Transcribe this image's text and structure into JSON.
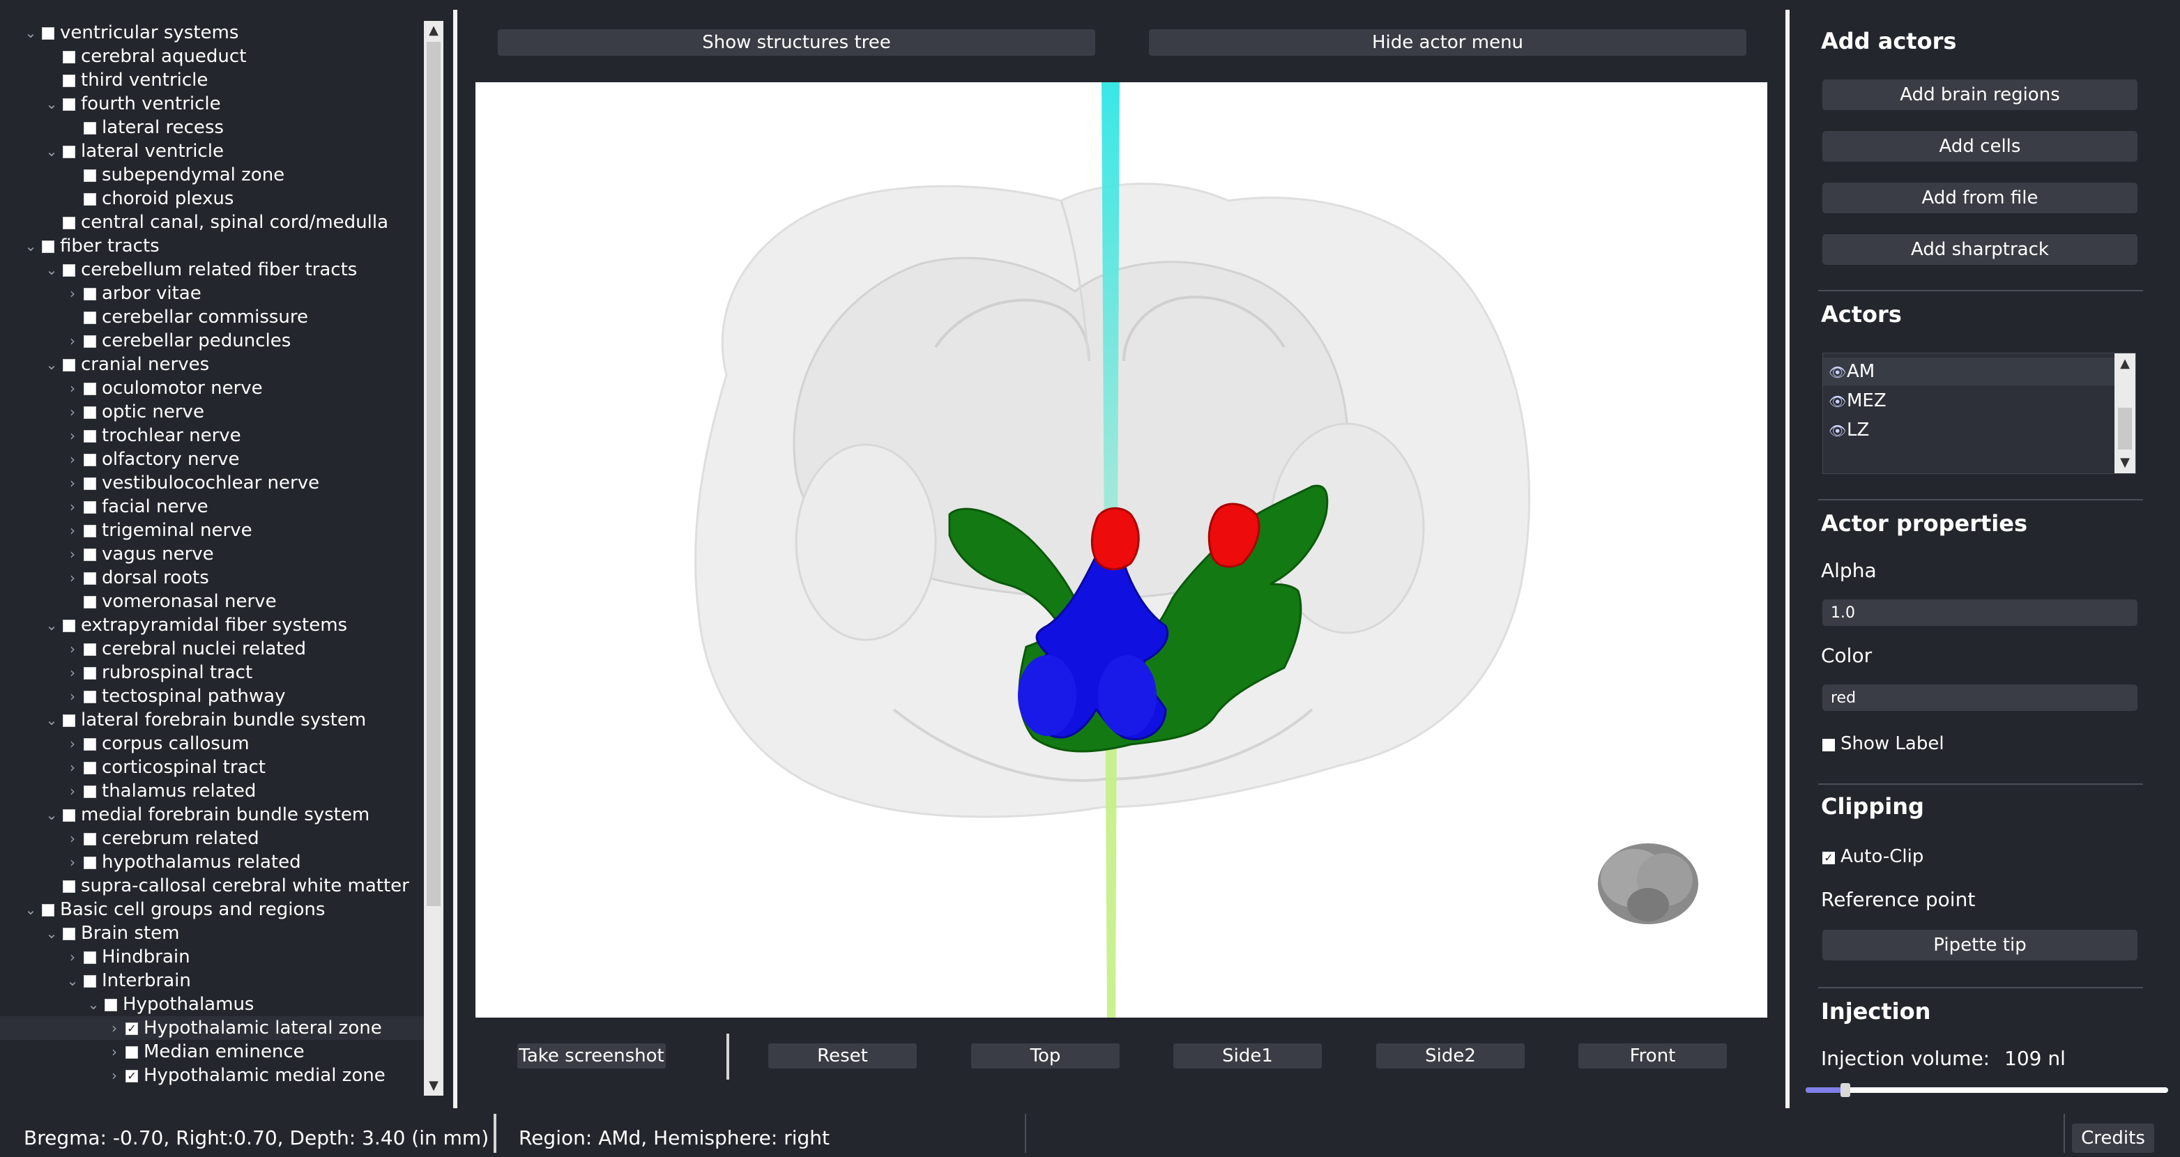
{
  "tree": {
    "items": [
      {
        "level": 0,
        "expanded": true,
        "checked": false,
        "label": "ventricular systems"
      },
      {
        "level": 1,
        "expanded": null,
        "checked": false,
        "label": "cerebral aqueduct"
      },
      {
        "level": 1,
        "expanded": null,
        "checked": false,
        "label": "third ventricle"
      },
      {
        "level": 1,
        "expanded": true,
        "checked": false,
        "label": "fourth ventricle"
      },
      {
        "level": 2,
        "expanded": null,
        "checked": false,
        "label": "lateral recess"
      },
      {
        "level": 1,
        "expanded": true,
        "checked": false,
        "label": "lateral ventricle"
      },
      {
        "level": 2,
        "expanded": null,
        "checked": false,
        "label": "subependymal zone"
      },
      {
        "level": 2,
        "expanded": null,
        "checked": false,
        "label": "choroid plexus"
      },
      {
        "level": 1,
        "expanded": null,
        "checked": false,
        "label": "central canal, spinal cord/medulla"
      },
      {
        "level": 0,
        "expanded": true,
        "checked": false,
        "label": "fiber tracts"
      },
      {
        "level": 1,
        "expanded": true,
        "checked": false,
        "label": "cerebellum related fiber tracts"
      },
      {
        "level": 2,
        "expanded": false,
        "checked": false,
        "label": "arbor vitae"
      },
      {
        "level": 2,
        "expanded": null,
        "checked": false,
        "label": "cerebellar commissure"
      },
      {
        "level": 2,
        "expanded": false,
        "checked": false,
        "label": "cerebellar peduncles"
      },
      {
        "level": 1,
        "expanded": true,
        "checked": false,
        "label": "cranial nerves"
      },
      {
        "level": 2,
        "expanded": false,
        "checked": false,
        "label": "oculomotor nerve"
      },
      {
        "level": 2,
        "expanded": false,
        "checked": false,
        "label": "optic nerve"
      },
      {
        "level": 2,
        "expanded": false,
        "checked": false,
        "label": "trochlear nerve"
      },
      {
        "level": 2,
        "expanded": false,
        "checked": false,
        "label": "olfactory nerve"
      },
      {
        "level": 2,
        "expanded": false,
        "checked": false,
        "label": "vestibulocochlear nerve"
      },
      {
        "level": 2,
        "expanded": false,
        "checked": false,
        "label": "facial nerve"
      },
      {
        "level": 2,
        "expanded": false,
        "checked": false,
        "label": "trigeminal nerve"
      },
      {
        "level": 2,
        "expanded": false,
        "checked": false,
        "label": "vagus nerve"
      },
      {
        "level": 2,
        "expanded": false,
        "checked": false,
        "label": "dorsal roots"
      },
      {
        "level": 2,
        "expanded": null,
        "checked": false,
        "label": "vomeronasal nerve"
      },
      {
        "level": 1,
        "expanded": true,
        "checked": false,
        "label": "extrapyramidal fiber systems"
      },
      {
        "level": 2,
        "expanded": false,
        "checked": false,
        "label": "cerebral nuclei related"
      },
      {
        "level": 2,
        "expanded": false,
        "checked": false,
        "label": "rubrospinal tract"
      },
      {
        "level": 2,
        "expanded": false,
        "checked": false,
        "label": "tectospinal pathway"
      },
      {
        "level": 1,
        "expanded": true,
        "checked": false,
        "label": "lateral forebrain bundle system"
      },
      {
        "level": 2,
        "expanded": false,
        "checked": false,
        "label": "corpus callosum"
      },
      {
        "level": 2,
        "expanded": false,
        "checked": false,
        "label": "corticospinal tract"
      },
      {
        "level": 2,
        "expanded": false,
        "checked": false,
        "label": "thalamus related"
      },
      {
        "level": 1,
        "expanded": true,
        "checked": false,
        "label": "medial forebrain bundle system"
      },
      {
        "level": 2,
        "expanded": false,
        "checked": false,
        "label": "cerebrum related"
      },
      {
        "level": 2,
        "expanded": false,
        "checked": false,
        "label": "hypothalamus related"
      },
      {
        "level": 1,
        "expanded": null,
        "checked": false,
        "label": "supra-callosal cerebral white matter"
      },
      {
        "level": 0,
        "expanded": true,
        "checked": false,
        "label": "Basic cell groups and regions"
      },
      {
        "level": 1,
        "expanded": true,
        "checked": false,
        "label": "Brain stem"
      },
      {
        "level": 2,
        "expanded": false,
        "checked": false,
        "label": "Hindbrain"
      },
      {
        "level": 2,
        "expanded": true,
        "checked": false,
        "label": "Interbrain"
      },
      {
        "level": 3,
        "expanded": true,
        "checked": false,
        "label": "Hypothalamus"
      },
      {
        "level": 4,
        "expanded": false,
        "checked": true,
        "label": "Hypothalamic lateral zone",
        "selected": true
      },
      {
        "level": 4,
        "expanded": false,
        "checked": false,
        "label": "Median eminence"
      },
      {
        "level": 4,
        "expanded": false,
        "checked": true,
        "label": "Hypothalamic medial zone"
      }
    ]
  },
  "toolbar": {
    "show_tree_label": "Show structures tree",
    "hide_menu_label": "Hide actor menu"
  },
  "view_buttons": {
    "screenshot": "Take screenshot",
    "reset": "Reset",
    "top": "Top",
    "side1": "Side1",
    "side2": "Side2",
    "front": "Front"
  },
  "right_panel": {
    "add_actors_title": "Add actors",
    "add_brain_regions": "Add brain regions",
    "add_cells": "Add cells",
    "add_from_file": "Add from file",
    "add_sharptrack": "Add sharptrack",
    "actors_title": "Actors",
    "actors": [
      "AM",
      "MEZ",
      "LZ"
    ],
    "actor_properties_title": "Actor properties",
    "alpha_label": "Alpha",
    "alpha_value": "1.0",
    "color_label": "Color",
    "color_value": "red",
    "show_label": "Show Label",
    "show_label_checked": false,
    "clipping_title": "Clipping",
    "auto_clip_label": "Auto-Clip",
    "auto_clip_checked": true,
    "reference_point_label": "Reference point",
    "pipette_tip": "Pipette tip",
    "injection_title": "Injection",
    "injection_volume_label": "Injection volume:",
    "injection_volume_value": "109 nl",
    "injection_slider_fraction": 0.11
  },
  "status": {
    "coords": "Bregma: -0.70, Right:0.70, Depth: 3.40 (in mm)",
    "region": "Region: AMd, Hemisphere: right",
    "credits": "Credits"
  },
  "colors": {
    "background": "#23262d",
    "button": "#3a3d45",
    "region_lateral_zone": "#137a13",
    "region_medial_zone": "#1010e0",
    "region_am": "#ee0b0b",
    "probe_top": "#2fe6e6",
    "probe_bottom": "#c6f08a"
  }
}
